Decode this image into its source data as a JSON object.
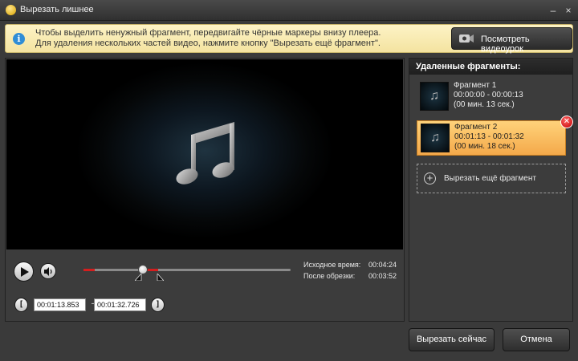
{
  "window": {
    "title": "Вырезать лишнее",
    "minimize_glyph": "–",
    "close_glyph": "×"
  },
  "hint": {
    "line1": "Чтобы выделить ненужный фрагмент, передвигайте чёрные маркеры внизу плеера.",
    "line2": "Для удаления нескольких частей видео, нажмите кнопку \"Вырезать ещё фрагмент\".",
    "info_glyph": "i",
    "video_lesson_label": "Посмотреть видеоурок"
  },
  "player": {
    "original_time_label": "Исходное время:",
    "original_time_value": "00:04:24",
    "after_trim_label": "После обрезки:",
    "after_trim_value": "00:03:52",
    "start_field": "00:01:13.853",
    "end_field": "00:01:32.726",
    "range_dash": "–",
    "start_bracket": "[",
    "end_bracket": "]"
  },
  "fragments": {
    "title": "Удаленные фрагменты:",
    "items": [
      {
        "name": "Фрагмент 1",
        "range": "00:00:00 - 00:00:13",
        "duration": "(00 мин. 13 сек.)",
        "thumb_glyph": "♫"
      },
      {
        "name": "Фрагмент 2",
        "range": "00:01:13 - 00:01:32",
        "duration": "(00 мин. 18 сек.)",
        "thumb_glyph": "♫"
      }
    ],
    "delete_glyph": "✕",
    "add_label": "Вырезать ещё фрагмент",
    "add_glyph": "+"
  },
  "footer": {
    "cut_now_label": "Вырезать сейчас",
    "cancel_label": "Отмена"
  },
  "colors": {
    "accent_red": "#d41e1e",
    "selected_fragment": "#f4a94a",
    "hint_bg": "#fdf3c6"
  }
}
